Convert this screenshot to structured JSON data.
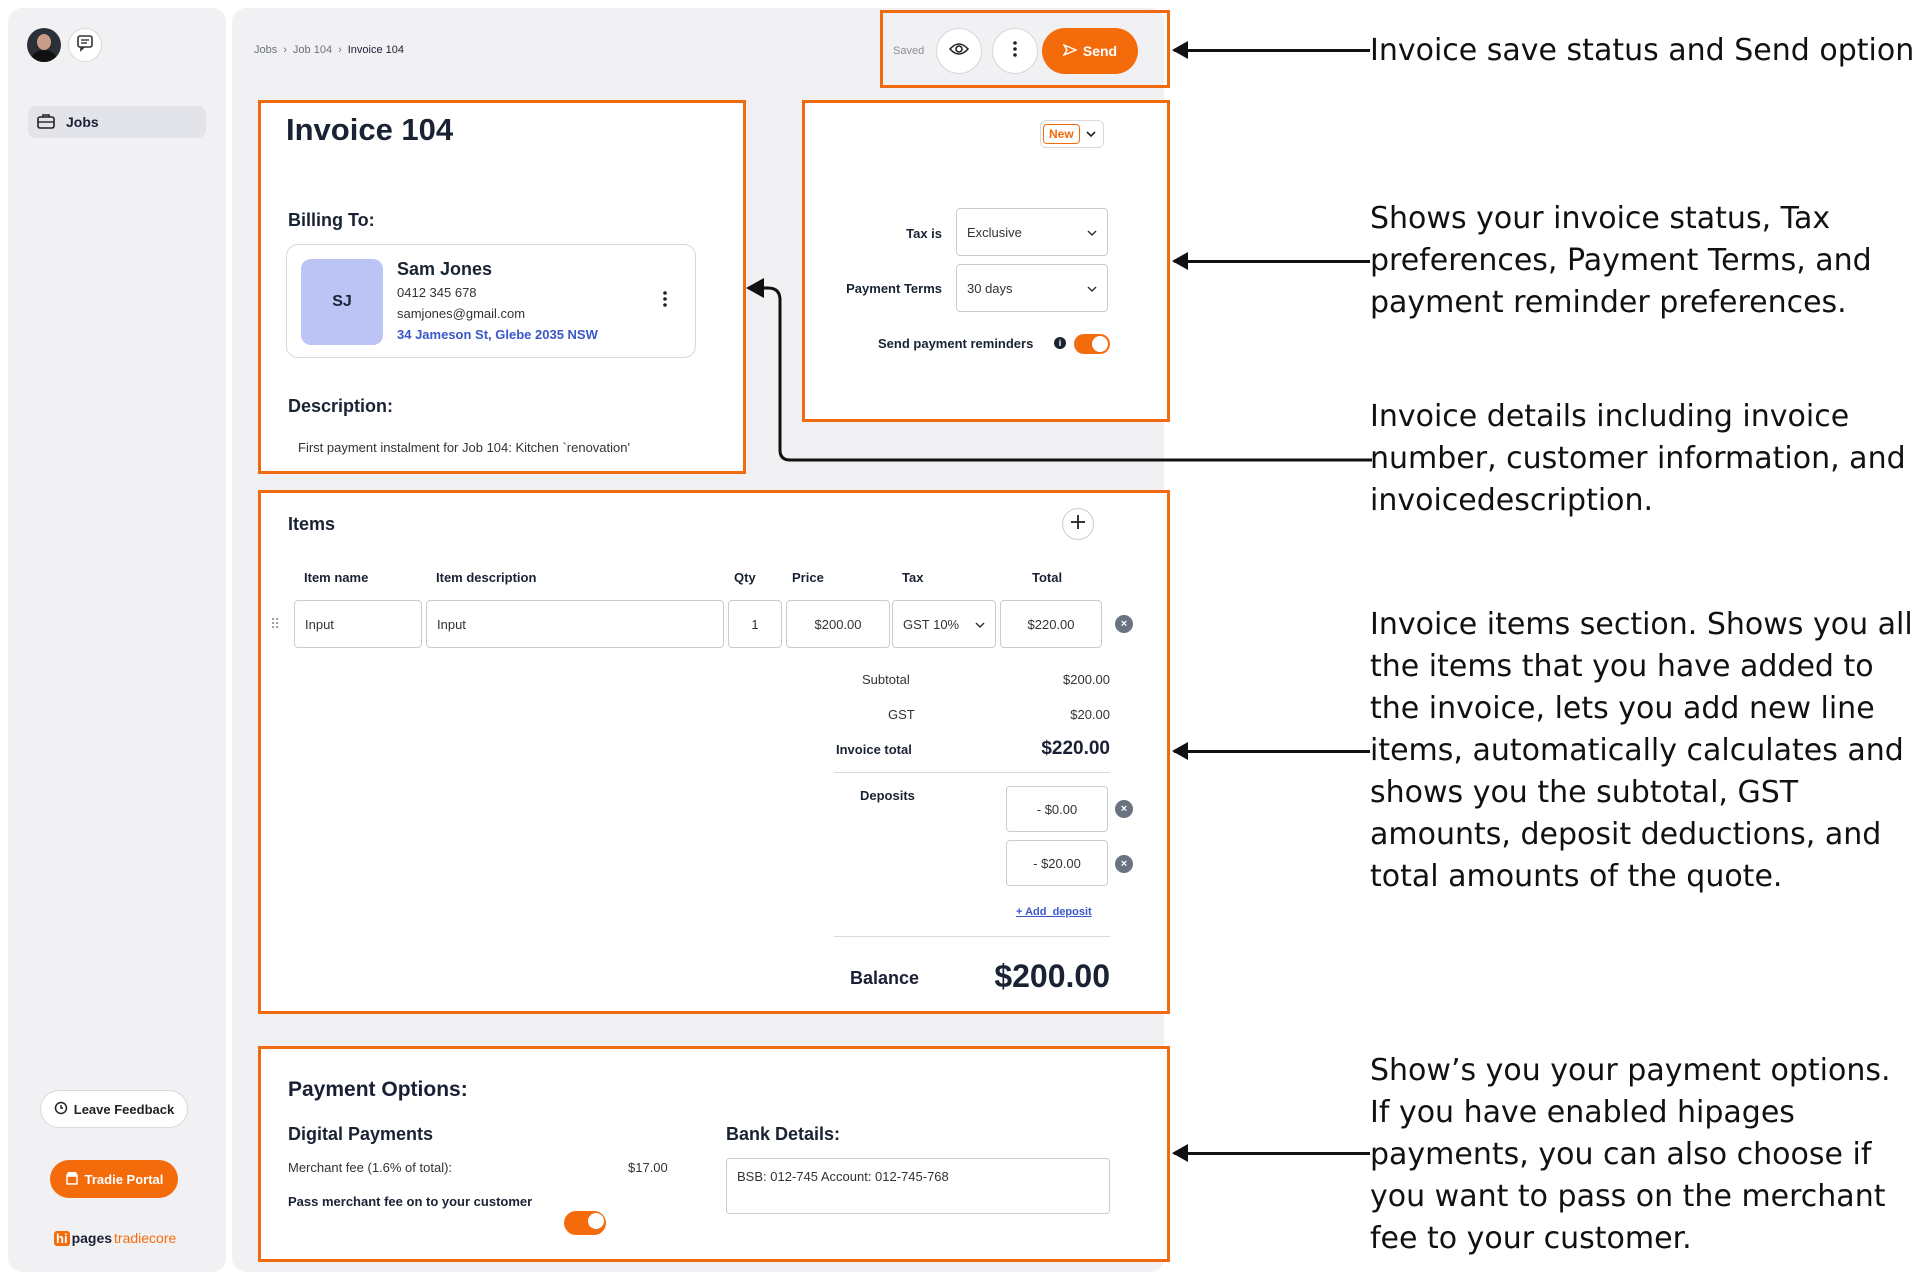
{
  "nav": {
    "jobs_label": "Jobs",
    "feedback_label": "Leave Feedback",
    "tradie_label": "Tradie Portal",
    "brand_hi": "hi",
    "brand_pages": "pages",
    "brand_tradiecore": "tradiecore"
  },
  "breadcrumb": [
    "Jobs",
    "Job 104",
    "Invoice 104"
  ],
  "toolbar": {
    "saved_label": "Saved",
    "send_label": "Send"
  },
  "invoice": {
    "title": "Invoice 104",
    "billing_label": "Billing To:",
    "customer": {
      "initials": "SJ",
      "name": "Sam Jones",
      "phone": "0412 345 678",
      "email": "samjones@gmail.com",
      "address": "34 Jameson St, Glebe 2035 NSW"
    },
    "description_label": "Description:",
    "description": "First payment instalment for Job 104: Kitchen `renovation'"
  },
  "settings": {
    "status": "New",
    "tax_label": "Tax is",
    "tax_value": "Exclusive",
    "terms_label": "Payment Terms",
    "terms_value": "30 days",
    "reminders_label": "Send payment reminders",
    "reminders_on": true
  },
  "items": {
    "title": "Items",
    "headers": {
      "name": "Item name",
      "description": "Item description",
      "qty": "Qty",
      "price": "Price",
      "tax": "Tax",
      "total": "Total"
    },
    "rows": [
      {
        "name": "Input",
        "description": "Input",
        "qty": "1",
        "price": "$200.00",
        "tax": "GST 10%",
        "total": "$220.00"
      }
    ],
    "subtotal_label": "Subtotal",
    "subtotal": "$200.00",
    "gst_label": "GST",
    "gst": "$20.00",
    "total_label": "Invoice total",
    "total": "$220.00",
    "deposits_label": "Deposits",
    "deposits": [
      "- $0.00",
      "- $20.00"
    ],
    "add_deposit": "+ Add  deposit",
    "balance_label": "Balance",
    "balance": "$200.00"
  },
  "payment": {
    "title": "Payment Options:",
    "digital_label": "Digital Payments",
    "merchant_fee_label": "Merchant fee (1.6% of total):",
    "merchant_fee": "$17.00",
    "pass_fee_label": "Pass merchant fee on to your customer",
    "pass_fee_on": true,
    "bank_label": "Bank Details:",
    "bank_value": "BSB: 012-745 Account: 012-745-768"
  },
  "annotations": [
    "Invoice save status and Send option",
    "Shows your invoice status, Tax preferences, Payment Terms, and payment reminder preferences.",
    "Invoice details including  invoice number, customer information, and invoicedescription.",
    "Invoice items section. Shows you all the items that you have added to the invoice, lets you add new line items, automatically calculates and shows you the subtotal, GST amounts, deposit deductions,  and total amounts of the quote.",
    "Show’s you your payment options. If you have enabled hipages payments, you can also choose if you want to pass on the merchant fee to your customer."
  ],
  "colors": {
    "accent": "#f46b0c",
    "highlight": "#f06a0f",
    "link": "#3b57c8",
    "avatar_bg": "#bcc4f5"
  }
}
